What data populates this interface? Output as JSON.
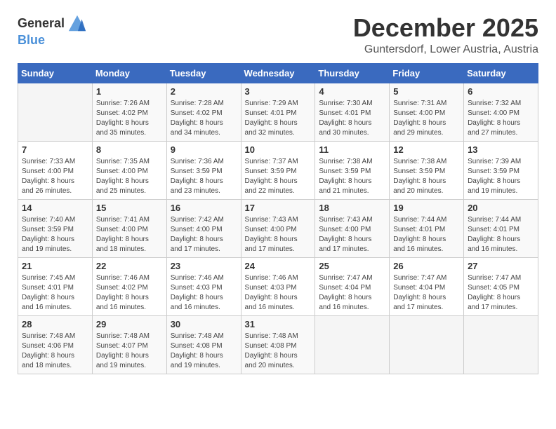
{
  "header": {
    "logo_general": "General",
    "logo_blue": "Blue",
    "month_title": "December 2025",
    "location": "Guntersdorf, Lower Austria, Austria"
  },
  "calendar": {
    "days_of_week": [
      "Sunday",
      "Monday",
      "Tuesday",
      "Wednesday",
      "Thursday",
      "Friday",
      "Saturday"
    ],
    "weeks": [
      [
        {
          "day": "",
          "content": ""
        },
        {
          "day": "1",
          "content": "Sunrise: 7:26 AM\nSunset: 4:02 PM\nDaylight: 8 hours\nand 35 minutes."
        },
        {
          "day": "2",
          "content": "Sunrise: 7:28 AM\nSunset: 4:02 PM\nDaylight: 8 hours\nand 34 minutes."
        },
        {
          "day": "3",
          "content": "Sunrise: 7:29 AM\nSunset: 4:01 PM\nDaylight: 8 hours\nand 32 minutes."
        },
        {
          "day": "4",
          "content": "Sunrise: 7:30 AM\nSunset: 4:01 PM\nDaylight: 8 hours\nand 30 minutes."
        },
        {
          "day": "5",
          "content": "Sunrise: 7:31 AM\nSunset: 4:00 PM\nDaylight: 8 hours\nand 29 minutes."
        },
        {
          "day": "6",
          "content": "Sunrise: 7:32 AM\nSunset: 4:00 PM\nDaylight: 8 hours\nand 27 minutes."
        }
      ],
      [
        {
          "day": "7",
          "content": "Sunrise: 7:33 AM\nSunset: 4:00 PM\nDaylight: 8 hours\nand 26 minutes."
        },
        {
          "day": "8",
          "content": "Sunrise: 7:35 AM\nSunset: 4:00 PM\nDaylight: 8 hours\nand 25 minutes."
        },
        {
          "day": "9",
          "content": "Sunrise: 7:36 AM\nSunset: 3:59 PM\nDaylight: 8 hours\nand 23 minutes."
        },
        {
          "day": "10",
          "content": "Sunrise: 7:37 AM\nSunset: 3:59 PM\nDaylight: 8 hours\nand 22 minutes."
        },
        {
          "day": "11",
          "content": "Sunrise: 7:38 AM\nSunset: 3:59 PM\nDaylight: 8 hours\nand 21 minutes."
        },
        {
          "day": "12",
          "content": "Sunrise: 7:38 AM\nSunset: 3:59 PM\nDaylight: 8 hours\nand 20 minutes."
        },
        {
          "day": "13",
          "content": "Sunrise: 7:39 AM\nSunset: 3:59 PM\nDaylight: 8 hours\nand 19 minutes."
        }
      ],
      [
        {
          "day": "14",
          "content": "Sunrise: 7:40 AM\nSunset: 3:59 PM\nDaylight: 8 hours\nand 19 minutes."
        },
        {
          "day": "15",
          "content": "Sunrise: 7:41 AM\nSunset: 4:00 PM\nDaylight: 8 hours\nand 18 minutes."
        },
        {
          "day": "16",
          "content": "Sunrise: 7:42 AM\nSunset: 4:00 PM\nDaylight: 8 hours\nand 17 minutes."
        },
        {
          "day": "17",
          "content": "Sunrise: 7:43 AM\nSunset: 4:00 PM\nDaylight: 8 hours\nand 17 minutes."
        },
        {
          "day": "18",
          "content": "Sunrise: 7:43 AM\nSunset: 4:00 PM\nDaylight: 8 hours\nand 17 minutes."
        },
        {
          "day": "19",
          "content": "Sunrise: 7:44 AM\nSunset: 4:01 PM\nDaylight: 8 hours\nand 16 minutes."
        },
        {
          "day": "20",
          "content": "Sunrise: 7:44 AM\nSunset: 4:01 PM\nDaylight: 8 hours\nand 16 minutes."
        }
      ],
      [
        {
          "day": "21",
          "content": "Sunrise: 7:45 AM\nSunset: 4:01 PM\nDaylight: 8 hours\nand 16 minutes."
        },
        {
          "day": "22",
          "content": "Sunrise: 7:46 AM\nSunset: 4:02 PM\nDaylight: 8 hours\nand 16 minutes."
        },
        {
          "day": "23",
          "content": "Sunrise: 7:46 AM\nSunset: 4:03 PM\nDaylight: 8 hours\nand 16 minutes."
        },
        {
          "day": "24",
          "content": "Sunrise: 7:46 AM\nSunset: 4:03 PM\nDaylight: 8 hours\nand 16 minutes."
        },
        {
          "day": "25",
          "content": "Sunrise: 7:47 AM\nSunset: 4:04 PM\nDaylight: 8 hours\nand 16 minutes."
        },
        {
          "day": "26",
          "content": "Sunrise: 7:47 AM\nSunset: 4:04 PM\nDaylight: 8 hours\nand 17 minutes."
        },
        {
          "day": "27",
          "content": "Sunrise: 7:47 AM\nSunset: 4:05 PM\nDaylight: 8 hours\nand 17 minutes."
        }
      ],
      [
        {
          "day": "28",
          "content": "Sunrise: 7:48 AM\nSunset: 4:06 PM\nDaylight: 8 hours\nand 18 minutes."
        },
        {
          "day": "29",
          "content": "Sunrise: 7:48 AM\nSunset: 4:07 PM\nDaylight: 8 hours\nand 19 minutes."
        },
        {
          "day": "30",
          "content": "Sunrise: 7:48 AM\nSunset: 4:08 PM\nDaylight: 8 hours\nand 19 minutes."
        },
        {
          "day": "31",
          "content": "Sunrise: 7:48 AM\nSunset: 4:08 PM\nDaylight: 8 hours\nand 20 minutes."
        },
        {
          "day": "",
          "content": ""
        },
        {
          "day": "",
          "content": ""
        },
        {
          "day": "",
          "content": ""
        }
      ]
    ]
  }
}
